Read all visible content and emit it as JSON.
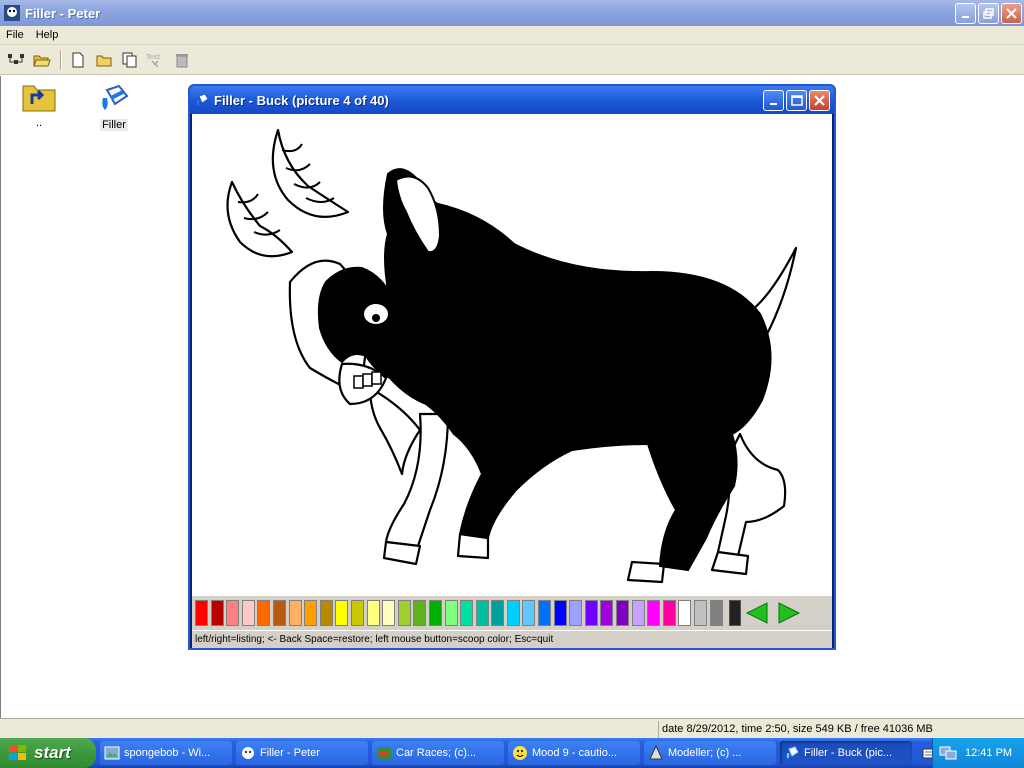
{
  "window": {
    "title": "Filler - Peter"
  },
  "menu": {
    "file": "File",
    "help": "Help"
  },
  "toolbar": {
    "text_label": "Text"
  },
  "desktop": {
    "up_label": "..",
    "filler_label": "Filler"
  },
  "child": {
    "title": "Filler - Buck (picture 4 of 40)",
    "hint": "left/right=listing;   <- Back Space=restore;   left mouse button=scoop color;   Esc=quit",
    "palette": [
      "#ff0000",
      "#b80000",
      "#ff8080",
      "#ffc8c8",
      "#ff6a00",
      "#b85a14",
      "#ffb060",
      "#ffa000",
      "#b88a00",
      "#ffff00",
      "#c8c800",
      "#ffff80",
      "#ffffc0",
      "#a0d030",
      "#60b020",
      "#00b000",
      "#80ff80",
      "#00e0a0",
      "#00c0a0",
      "#00a0a0",
      "#00d0ff",
      "#60c8ff",
      "#0070ff",
      "#0000ff",
      "#a0a0ff",
      "#7000ff",
      "#a000e0",
      "#8000c0",
      "#c8a0ff",
      "#ff00ff",
      "#ff00a0",
      "#ffffff",
      "#c0c0c0",
      "#808080"
    ]
  },
  "status": {
    "info": "date 8/29/2012, time 2:50, size 549 KB / free 41036 MB"
  },
  "taskbar": {
    "start": "start",
    "tasks": [
      "spongebob - Wi...",
      "Filler - Peter",
      "Car Races;  (c)...",
      "Mood 9 - cautio...",
      "Modeller;  (c) ...",
      "Filler - Buck (pic..."
    ],
    "clock": "12:41 PM"
  }
}
